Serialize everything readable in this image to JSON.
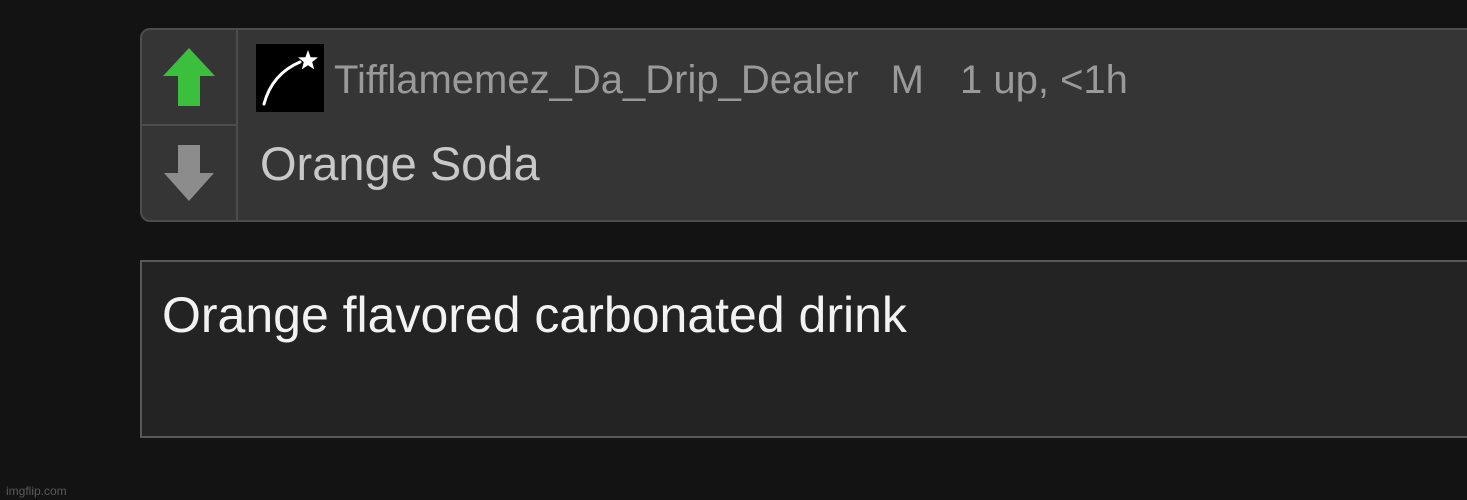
{
  "post": {
    "username": "Tifflamemez_Da_Drip_Dealer",
    "badge": "M",
    "score_time": "1 up, <1h",
    "title": "Orange Soda",
    "upvote_color": "#3cbf3c",
    "downvote_color": "#8c8c8c",
    "avatar_icon": "shooting-star-icon"
  },
  "description": {
    "text": "Orange flavored carbonated drink"
  },
  "watermark": "imgflip.com"
}
